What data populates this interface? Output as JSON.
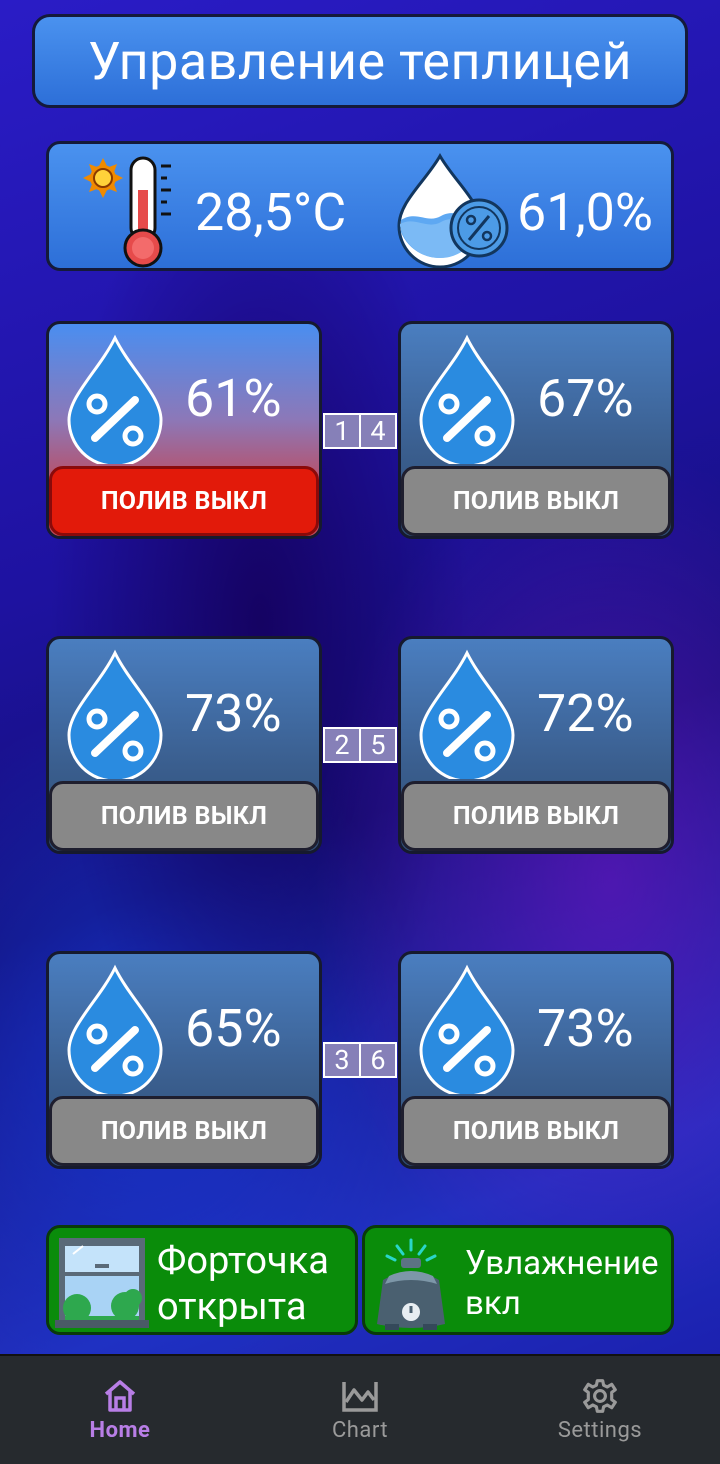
{
  "header": {
    "title": "Управление теплицей"
  },
  "sensors": {
    "temperature": "28,5°C",
    "humidity": "61,0%"
  },
  "zones": [
    {
      "moisture": "61%",
      "watering_label": "ПОЛИВ ВЫКЛ",
      "active": true
    },
    {
      "moisture": "67%",
      "watering_label": "ПОЛИВ ВЫКЛ",
      "active": false
    },
    {
      "moisture": "73%",
      "watering_label": "ПОЛИВ ВЫКЛ",
      "active": false
    },
    {
      "moisture": "72%",
      "watering_label": "ПОЛИВ ВЫКЛ",
      "active": false
    },
    {
      "moisture": "65%",
      "watering_label": "ПОЛИВ ВЫКЛ",
      "active": false
    },
    {
      "moisture": "73%",
      "watering_label": "ПОЛИВ ВЫКЛ",
      "active": false
    }
  ],
  "pair_labels": [
    {
      "left": "1",
      "right": "4"
    },
    {
      "left": "2",
      "right": "5"
    },
    {
      "left": "3",
      "right": "6"
    }
  ],
  "window_control": {
    "line1": "Форточка",
    "line2": "открыта",
    "icon": "window-icon"
  },
  "humidifier_control": {
    "line1": "Увлажнение",
    "line2": "вкл",
    "icon": "humidifier-icon"
  },
  "nav": {
    "items": [
      {
        "label": "Home",
        "icon": "home-icon",
        "active": true
      },
      {
        "label": "Chart",
        "icon": "chart-icon",
        "active": false
      },
      {
        "label": "Settings",
        "icon": "gear-icon",
        "active": false
      }
    ]
  },
  "colors": {
    "panel_blue": "#3b82e6",
    "active_red": "#e21a0a",
    "button_gray": "#888888",
    "status_green": "#0a8c0a",
    "nav_active": "#b87ee6"
  }
}
